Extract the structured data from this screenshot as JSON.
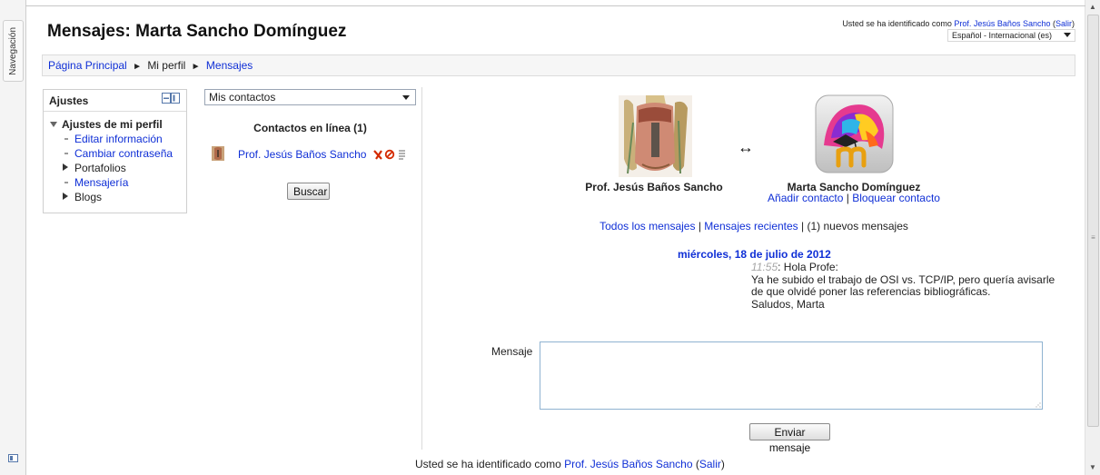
{
  "dock": {
    "tab_label": "Navegación"
  },
  "header": {
    "title": "Mensajes: Marta Sancho Domínguez",
    "login_prefix": "Usted se ha identificado como",
    "login_user": "Prof. Jesús Baños Sancho",
    "logout_open": "(",
    "logout_label": "Salir",
    "logout_close": ")",
    "language": "Español - Internacional (es)"
  },
  "breadcrumb": {
    "home": "Página Principal",
    "profile": "Mi perfil",
    "messages": "Mensajes"
  },
  "settings_block": {
    "title": "Ajustes",
    "root": "Ajustes de mi perfil",
    "items": [
      {
        "label": "Editar información"
      },
      {
        "label": "Cambiar contraseña"
      },
      {
        "label": "Portafolios"
      },
      {
        "label": "Mensajería"
      },
      {
        "label": "Blogs"
      }
    ]
  },
  "contacts": {
    "selected_list": "Mis contactos",
    "heading": "Contactos en línea (1)",
    "online": [
      {
        "name": "Prof. Jesús Baños Sancho"
      }
    ],
    "search_button": "Buscar"
  },
  "conversation": {
    "user_left": "Prof. Jesús Baños Sancho",
    "user_right": "Marta Sancho Domínguez",
    "add_contact": "Añadir contacto",
    "block_contact": "Bloquear contacto",
    "link_separator": "|",
    "all_messages": "Todos los mensajes",
    "recent_messages": "Mensajes recientes",
    "new_messages": "(1) nuevos mensajes",
    "date": "miércoles, 18 de julio de 2012",
    "messages": [
      {
        "time": "11:55",
        "greeting": ": Hola Profe:",
        "line1": "Ya he subido el trabajo de OSI vs. TCP/IP, pero quería avisarle de que olvidé poner las referencias bibliográficas.",
        "line2": "Saludos, Marta"
      }
    ]
  },
  "form": {
    "label": "Mensaje",
    "message_value": "",
    "send_button": "Enviar mensaje"
  },
  "footer": {
    "login_prefix": "Usted se ha identificado como",
    "login_user": "Prof. Jesús Baños Sancho",
    "logout_open": "(",
    "logout_label": "Salir",
    "logout_close": ")"
  },
  "colors": {
    "link": "#0f2fd6",
    "accent_purple": "#8c2f8c"
  }
}
